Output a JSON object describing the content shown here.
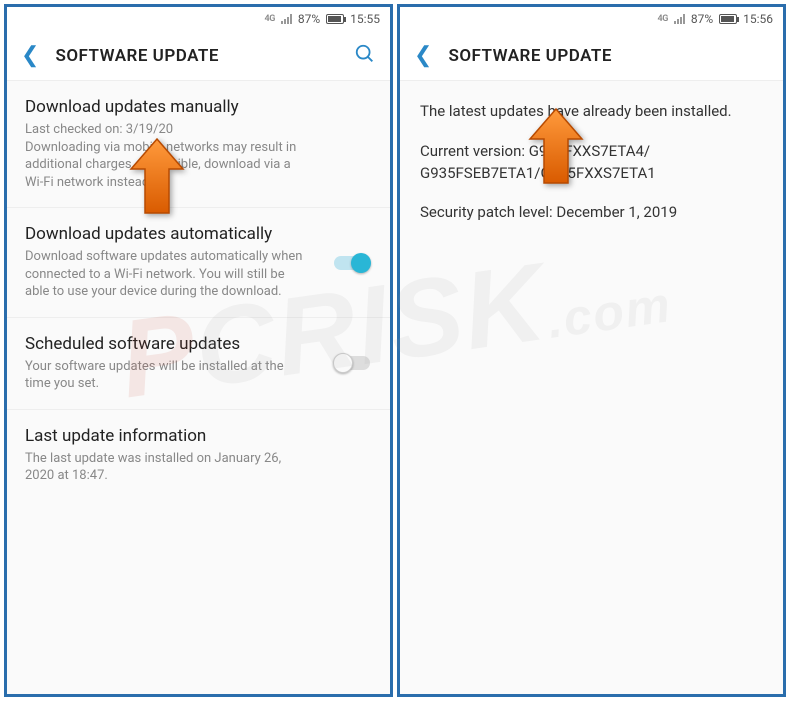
{
  "watermark": {
    "red_part": "P",
    "gray_part": "CRISK",
    "suffix": ".com"
  },
  "left": {
    "status": {
      "network": "4G",
      "battery_pct": "87%",
      "time": "15:55"
    },
    "appbar": {
      "title": "SOFTWARE UPDATE"
    },
    "items": {
      "manual": {
        "title": "Download updates manually",
        "desc": "Last checked on: 3/19/20\nDownloading via mobile networks may result in additional charges. If possible, download via a Wi-Fi network instead."
      },
      "auto": {
        "title": "Download updates automatically",
        "desc": "Download software updates automatically when connected to a Wi-Fi network. You will still be able to use your device during the download.",
        "toggle": "on"
      },
      "scheduled": {
        "title": "Scheduled software updates",
        "desc": "Your software updates will be installed at the time you set.",
        "toggle": "off"
      },
      "last": {
        "title": "Last update information",
        "desc": "The last update was installed on January 26, 2020 at 18:47."
      }
    }
  },
  "right": {
    "status": {
      "network": "4G",
      "battery_pct": "87%",
      "time": "15:56"
    },
    "appbar": {
      "title": "SOFTWARE UPDATE"
    },
    "info": {
      "installed_msg": "The latest updates have already been installed.",
      "version_line1": "Current version: G935FXXS7ETA4/",
      "version_line2": "G935FSEB7ETA1/G935FXXS7ETA1",
      "security_patch": "Security patch level: December 1, 2019"
    }
  }
}
